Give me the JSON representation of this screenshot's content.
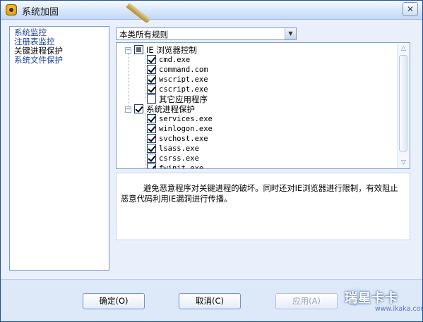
{
  "window": {
    "title": "系统加固",
    "close_label": "✕"
  },
  "sidebar": {
    "items": [
      {
        "label": "系统监控"
      },
      {
        "label": "注册表监控"
      },
      {
        "label": "关键进程保护"
      },
      {
        "label": "系统文件保护"
      }
    ]
  },
  "filter": {
    "selected": "本类所有规则"
  },
  "tree": {
    "groups": [
      {
        "label": "IE 浏览器控制",
        "state": "partial",
        "children": [
          {
            "label": "cmd.exe",
            "checked": true
          },
          {
            "label": "command.com",
            "checked": true
          },
          {
            "label": "wscript.exe",
            "checked": true
          },
          {
            "label": "cscript.exe",
            "checked": true
          },
          {
            "label": "其它应用程序",
            "checked": false
          }
        ]
      },
      {
        "label": "系统进程保护",
        "state": "checked",
        "children": [
          {
            "label": "services.exe",
            "checked": true
          },
          {
            "label": "winlogon.exe",
            "checked": true
          },
          {
            "label": "svchost.exe",
            "checked": true
          },
          {
            "label": "lsass.exe",
            "checked": true
          },
          {
            "label": "csrss.exe",
            "checked": true
          },
          {
            "label": "fwinit.exe",
            "checked": true
          }
        ]
      }
    ]
  },
  "description": "避免恶意程序对关键进程的破坏。同时还对IE浏览器进行限制，有效阻止恶意代码利用IE漏洞进行传播。",
  "buttons": {
    "ok": "确定(O)",
    "cancel": "取消(C)",
    "apply": "应用(A)"
  },
  "watermark": {
    "brand": "瑞星卡卡",
    "url": "www.ikaka.com"
  },
  "colors": {
    "accent": "#1c3f9a",
    "border": "#7f9db9",
    "window_bg": "#e9f0fb"
  }
}
